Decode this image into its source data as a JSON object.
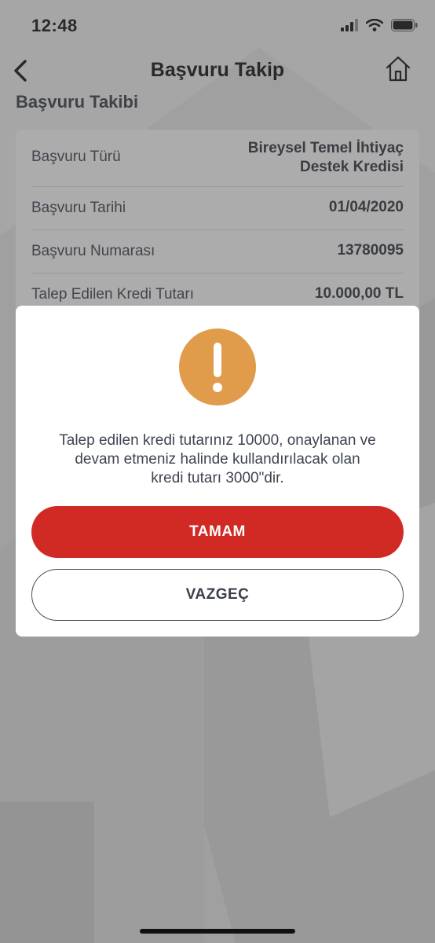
{
  "status_bar": {
    "time": "12:48"
  },
  "nav": {
    "title": "Başvuru Takip",
    "back_icon": "chevron-left-icon",
    "home_icon": "home-icon"
  },
  "section_title": "Başvuru Takibi",
  "details": [
    {
      "label": "Başvuru Türü",
      "value_line1": "Bireysel Temel İhtiyaç",
      "value_line2": "Destek Kredisi"
    },
    {
      "label": "Başvuru Tarihi",
      "value": "01/04/2020"
    },
    {
      "label": "Başvuru Numarası",
      "value": "13780095"
    },
    {
      "label": "Talep Edilen Kredi Tutarı",
      "value": "10.000,00 TL"
    }
  ],
  "modal": {
    "icon": "warning-icon",
    "message_line1": "Talep edilen kredi tutarınız 10000, onaylanan ve",
    "message_line2": "devam etmeniz halinde kullandırılacak olan",
    "message_line3": "kredi tutarı 3000\"dir.",
    "confirm_label": "TAMAM",
    "cancel_label": "VAZGEÇ"
  },
  "colors": {
    "accent_red": "#d12a25",
    "warning_orange": "#e09c4b",
    "text_dark": "#3e4450"
  }
}
